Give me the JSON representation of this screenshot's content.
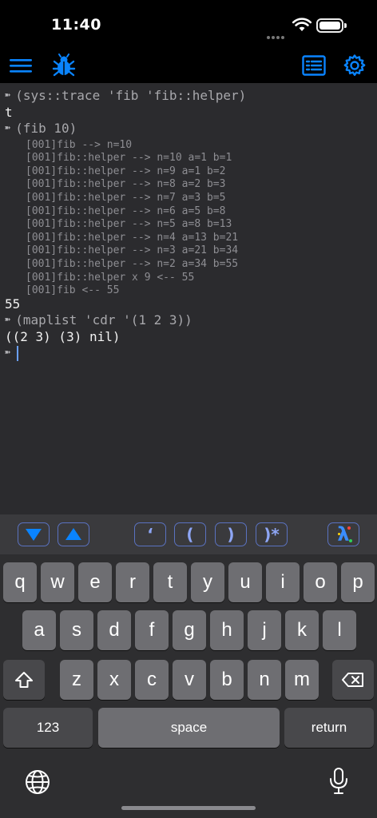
{
  "status": {
    "time": "11:40"
  },
  "console": {
    "lines": [
      {
        "kind": "prompt",
        "text": "(sys::trace 'fib 'fib::helper)"
      },
      {
        "kind": "result",
        "text": "t"
      },
      {
        "kind": "prompt",
        "text": "(fib 10)"
      },
      {
        "kind": "trace",
        "text": "[001]fib --> n=10"
      },
      {
        "kind": "trace",
        "text": "[001]fib::helper --> n=10 a=1 b=1"
      },
      {
        "kind": "trace",
        "text": "[001]fib::helper --> n=9 a=1 b=2"
      },
      {
        "kind": "trace",
        "text": "[001]fib::helper --> n=8 a=2 b=3"
      },
      {
        "kind": "trace",
        "text": "[001]fib::helper --> n=7 a=3 b=5"
      },
      {
        "kind": "trace",
        "text": "[001]fib::helper --> n=6 a=5 b=8"
      },
      {
        "kind": "trace",
        "text": "[001]fib::helper --> n=5 a=8 b=13"
      },
      {
        "kind": "trace",
        "text": "[001]fib::helper --> n=4 a=13 b=21"
      },
      {
        "kind": "trace",
        "text": "[001]fib::helper --> n=3 a=21 b=34"
      },
      {
        "kind": "trace",
        "text": "[001]fib::helper --> n=2 a=34 b=55"
      },
      {
        "kind": "trace",
        "text": "[001]fib::helper x 9 <-- 55"
      },
      {
        "kind": "trace",
        "text": "[001]fib <-- 55"
      },
      {
        "kind": "result",
        "text": "55"
      },
      {
        "kind": "prompt",
        "text": "(maplist 'cdr '(1 2 3))"
      },
      {
        "kind": "result",
        "text": "((2 3) (3) nil)"
      },
      {
        "kind": "prompt",
        "text": ""
      }
    ]
  },
  "accessory": {
    "quote_label": "‘",
    "open_paren_label": "(",
    "close_paren_label": ")",
    "close_all_label": ")*",
    "lambda_label": "λ"
  },
  "keyboard": {
    "row1": [
      "q",
      "w",
      "e",
      "r",
      "t",
      "y",
      "u",
      "i",
      "o",
      "p"
    ],
    "row2": [
      "a",
      "s",
      "d",
      "f",
      "g",
      "h",
      "j",
      "k",
      "l"
    ],
    "row3": [
      "z",
      "x",
      "c",
      "v",
      "b",
      "n",
      "m"
    ],
    "numbers_label": "123",
    "space_label": "space",
    "return_label": "return"
  },
  "colors": {
    "accent": "#0a84ff",
    "toolbar_button": "#5a72c0",
    "console_bg": "#2b2b2e",
    "key": "#6e6e72",
    "key_dark": "#48484b"
  }
}
